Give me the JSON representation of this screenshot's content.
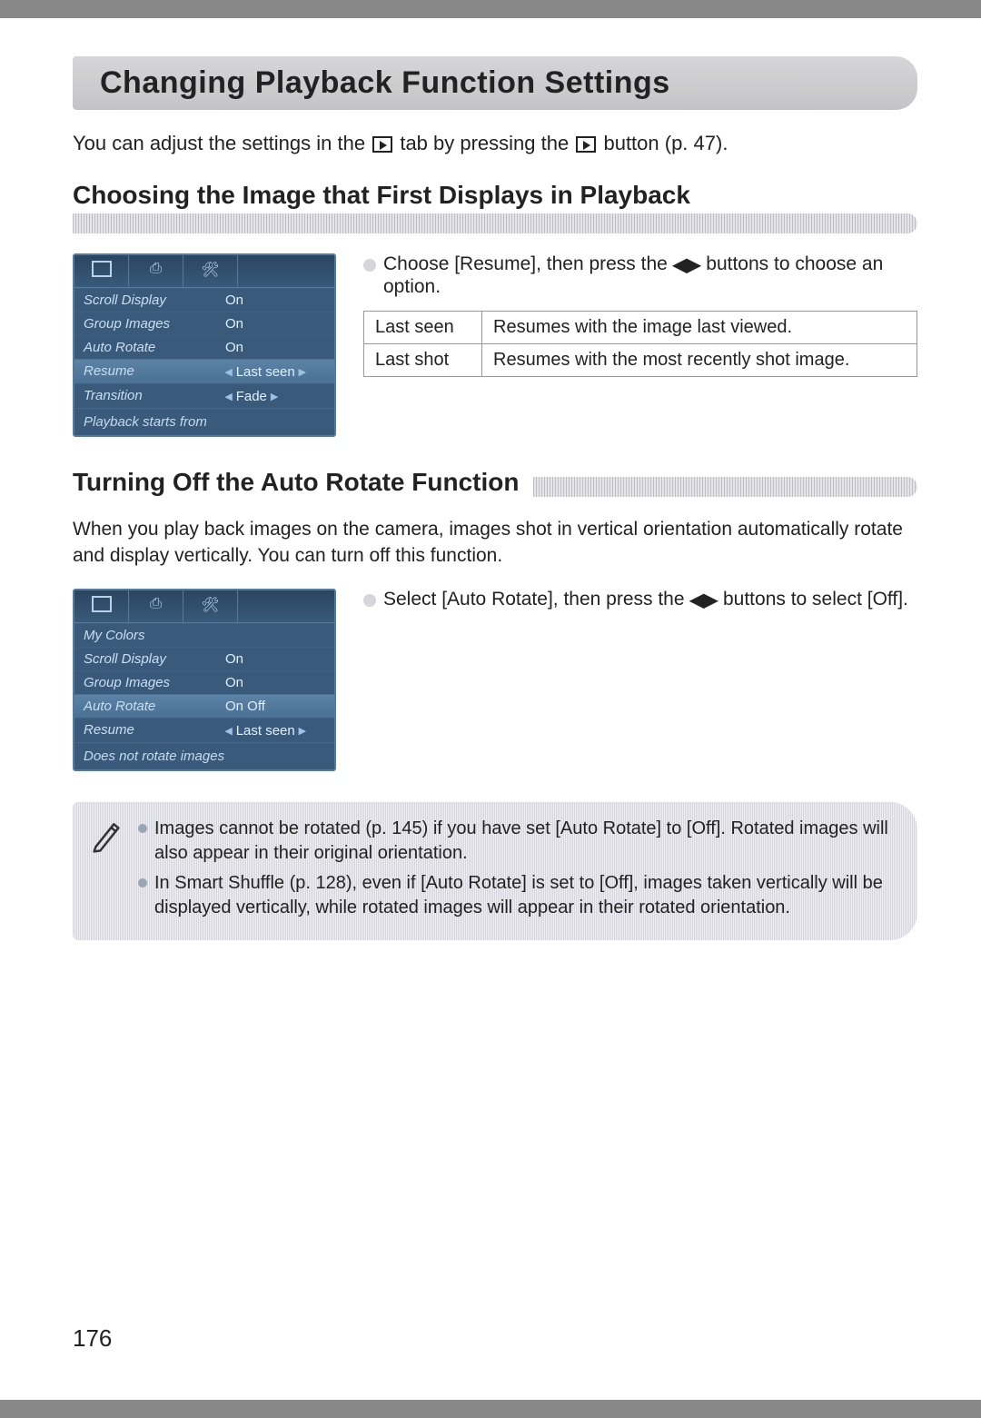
{
  "page": {
    "title": "Changing Playback Function Settings",
    "intro_pre": "You can adjust the settings in the ",
    "intro_mid": " tab by pressing the ",
    "intro_post": " button (p. 47).",
    "number": "176"
  },
  "section1": {
    "heading": "Choosing the Image that First Displays in Playback",
    "instruction_pre": "Choose [Resume], then press the ",
    "instruction_post": " buttons to choose an option.",
    "table": [
      {
        "term": "Last seen",
        "desc": "Resumes with the image last viewed."
      },
      {
        "term": "Last shot",
        "desc": "Resumes with the most recently shot image."
      }
    ],
    "lcd": {
      "rows": [
        {
          "label": "Scroll Display",
          "value": "On"
        },
        {
          "label": "Group Images",
          "value": "On"
        },
        {
          "label": "Auto Rotate",
          "value": "On"
        },
        {
          "label": "Resume",
          "value": "Last seen",
          "highlight": true,
          "chevrons": true
        },
        {
          "label": "Transition",
          "value": "Fade",
          "chevrons": true
        }
      ],
      "help": "Playback starts from"
    }
  },
  "section2": {
    "heading": "Turning Off the Auto Rotate Function",
    "body": "When you play back images on the camera, images shot in vertical orientation automatically rotate and display vertically. You can turn off this function.",
    "instruction_pre": "Select [Auto Rotate], then press the ",
    "instruction_post": " buttons to select [Off].",
    "lcd": {
      "rows": [
        {
          "label": "My Colors",
          "value": ""
        },
        {
          "label": "Scroll Display",
          "value": "On"
        },
        {
          "label": "Group Images",
          "value": "On"
        },
        {
          "label": "Auto Rotate",
          "value": "On  Off",
          "highlight": true
        },
        {
          "label": "Resume",
          "value": "Last seen",
          "chevrons": true
        }
      ],
      "help": "Does not rotate images"
    }
  },
  "notes": [
    "Images cannot be rotated (p. 145) if you have set [Auto Rotate] to [Off]. Rotated images will also appear in their original orientation.",
    "In Smart Shuffle (p. 128), even if [Auto Rotate] is set to [Off], images taken vertically will be displayed vertically, while rotated images will appear in their rotated orientation."
  ],
  "icons": {
    "play_tab": "playback-tab-icon",
    "print_tab": "print-tab-icon",
    "tools_tab": "tools-tab-icon",
    "lr": "◀▶",
    "pencil": "pencil-note-icon"
  }
}
